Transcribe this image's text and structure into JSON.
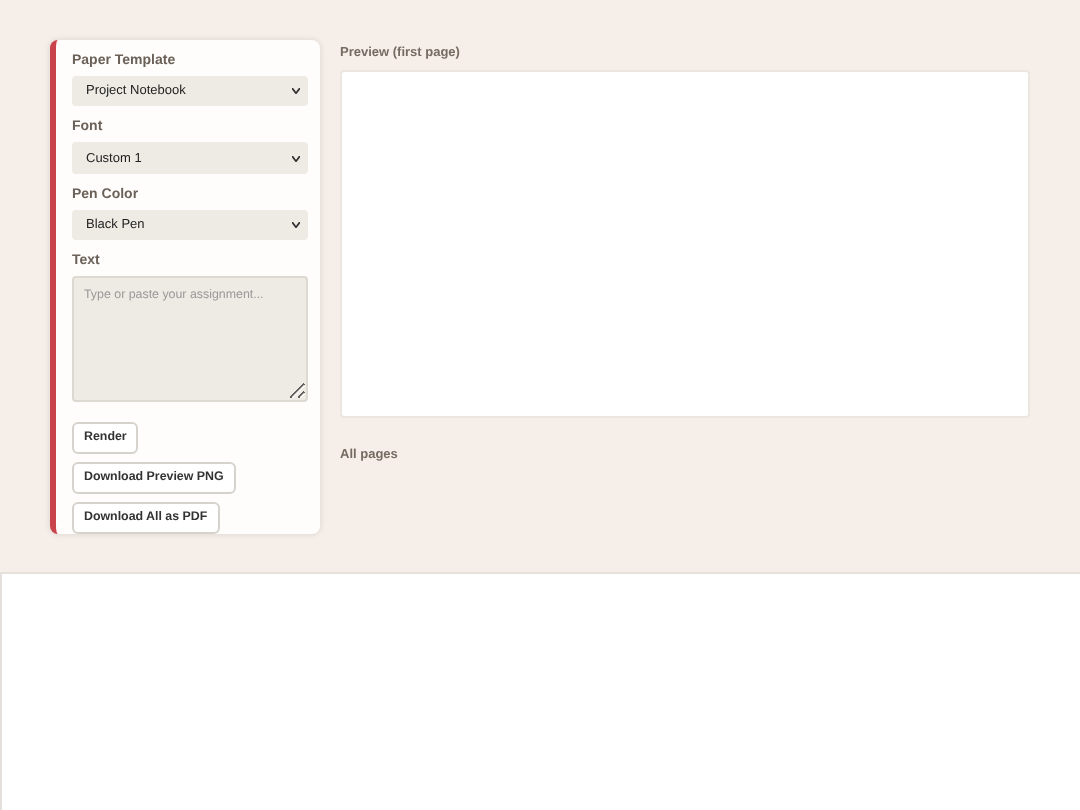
{
  "controls": {
    "fields": [
      {
        "label": "Paper Template",
        "value": "Project Notebook"
      },
      {
        "label": "Font",
        "value": "Custom 1"
      },
      {
        "label": "Pen Color",
        "value": "Black Pen"
      }
    ],
    "text": {
      "label": "Text",
      "placeholder": "Type or paste your assignment..."
    },
    "buttons": [
      "Render",
      "Download Preview PNG",
      "Download All as PDF"
    ]
  },
  "preview": {
    "title": "Preview (first page)",
    "all_pages_label": "All pages"
  }
}
